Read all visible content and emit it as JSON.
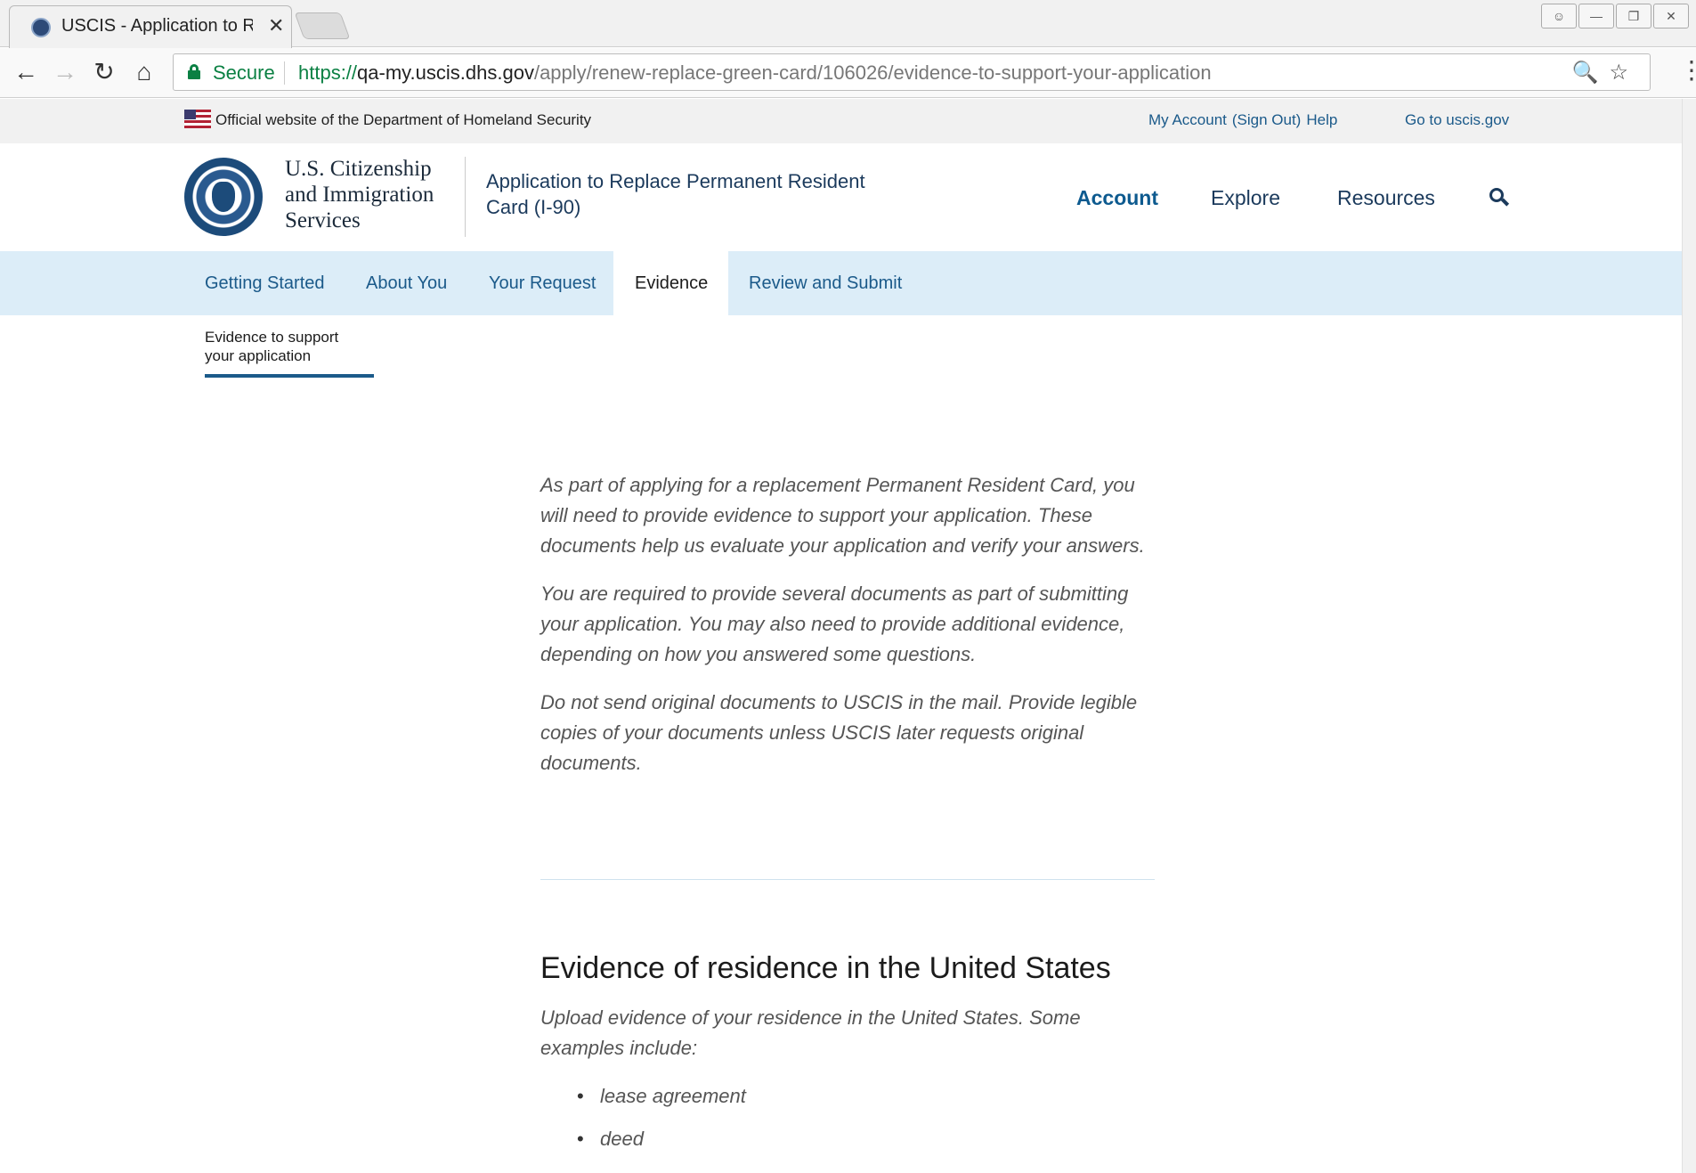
{
  "browser": {
    "tab_title": "USCIS - Application to Re",
    "tab_close": "✕",
    "secure_label": "Secure",
    "url_scheme": "https://",
    "url_host": "qa-my.uscis.dhs.gov",
    "url_path": "/apply/renew-replace-green-card/106026/evidence-to-support-your-application",
    "icons": [
      "back-icon",
      "forward-icon",
      "reload-icon",
      "home-icon",
      "zoom-icon",
      "star-icon",
      "menu-icon"
    ]
  },
  "gov_banner": {
    "official_text": "Official website of the Department of Homeland Security",
    "my_account": "My Account",
    "sign_out": "(Sign Out)",
    "help": "Help",
    "go_to": "Go to uscis.gov"
  },
  "header": {
    "agency_line1": "U.S. Citizenship",
    "agency_line2": "and Immigration",
    "agency_line3": "Services",
    "app_name": "Application to Replace Permanent Resident Card (I-90)",
    "nav": {
      "account": "Account",
      "explore": "Explore",
      "resources": "Resources"
    }
  },
  "steps": {
    "items": [
      {
        "label": "Getting Started"
      },
      {
        "label": "About You"
      },
      {
        "label": "Your Request"
      },
      {
        "label": "Evidence"
      },
      {
        "label": "Review and Submit"
      }
    ],
    "active": "Evidence",
    "substep_line1": "Evidence to support",
    "substep_line2": "your application"
  },
  "content": {
    "para1": "As part of applying for a replacement Permanent Resident Card, you will need to provide evidence to support your application. These documents help us evaluate your application and verify your answers.",
    "para2": "You are required to provide several documents as part of submitting your application. You may also need to provide additional evidence, depending on how you answered some questions.",
    "para3": "Do not send original documents to USCIS in the mail. Provide legible copies of your documents unless USCIS later requests original documents.",
    "section_title": "Evidence of residence in the United States",
    "section_desc": "Upload evidence of your residence in the United States. Some examples include:",
    "bullets": [
      "lease agreement",
      "deed"
    ]
  },
  "colors": {
    "link": "#1b5a8a",
    "steps_bg": "#dcedf8",
    "secure_green": "#0b8043"
  }
}
